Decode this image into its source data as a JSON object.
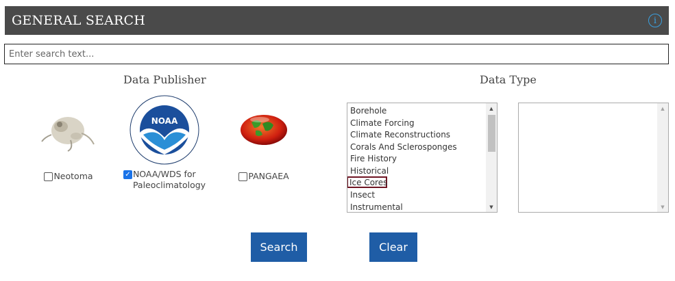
{
  "header": {
    "title": "GENERAL SEARCH",
    "info_icon": "info-circle-icon"
  },
  "search": {
    "placeholder": "Enter search text...",
    "value": ""
  },
  "publisher_section": {
    "heading": "Data Publisher",
    "publishers": [
      {
        "label": "Neotoma",
        "checked": false,
        "logo": "rodent-skull-logo"
      },
      {
        "label_line1": "NOAA/WDS for",
        "label_line2": "Paleoclimatology",
        "checked": true,
        "logo": "noaa-logo"
      },
      {
        "label": "PANGAEA",
        "checked": false,
        "logo": "pangaea-logo"
      }
    ]
  },
  "datatype_section": {
    "heading": "Data Type",
    "items": [
      "Borehole",
      "Climate Forcing",
      "Climate Reconstructions",
      "Corals And Sclerosponges",
      "Fire History",
      "Historical",
      "Ice Cores",
      "Insect",
      "Instrumental"
    ],
    "highlighted": "Ice Cores",
    "highlight_color": "#6e1422"
  },
  "buttons": {
    "search_label": "Search",
    "clear_label": "Clear",
    "color": "#1f5da6"
  }
}
